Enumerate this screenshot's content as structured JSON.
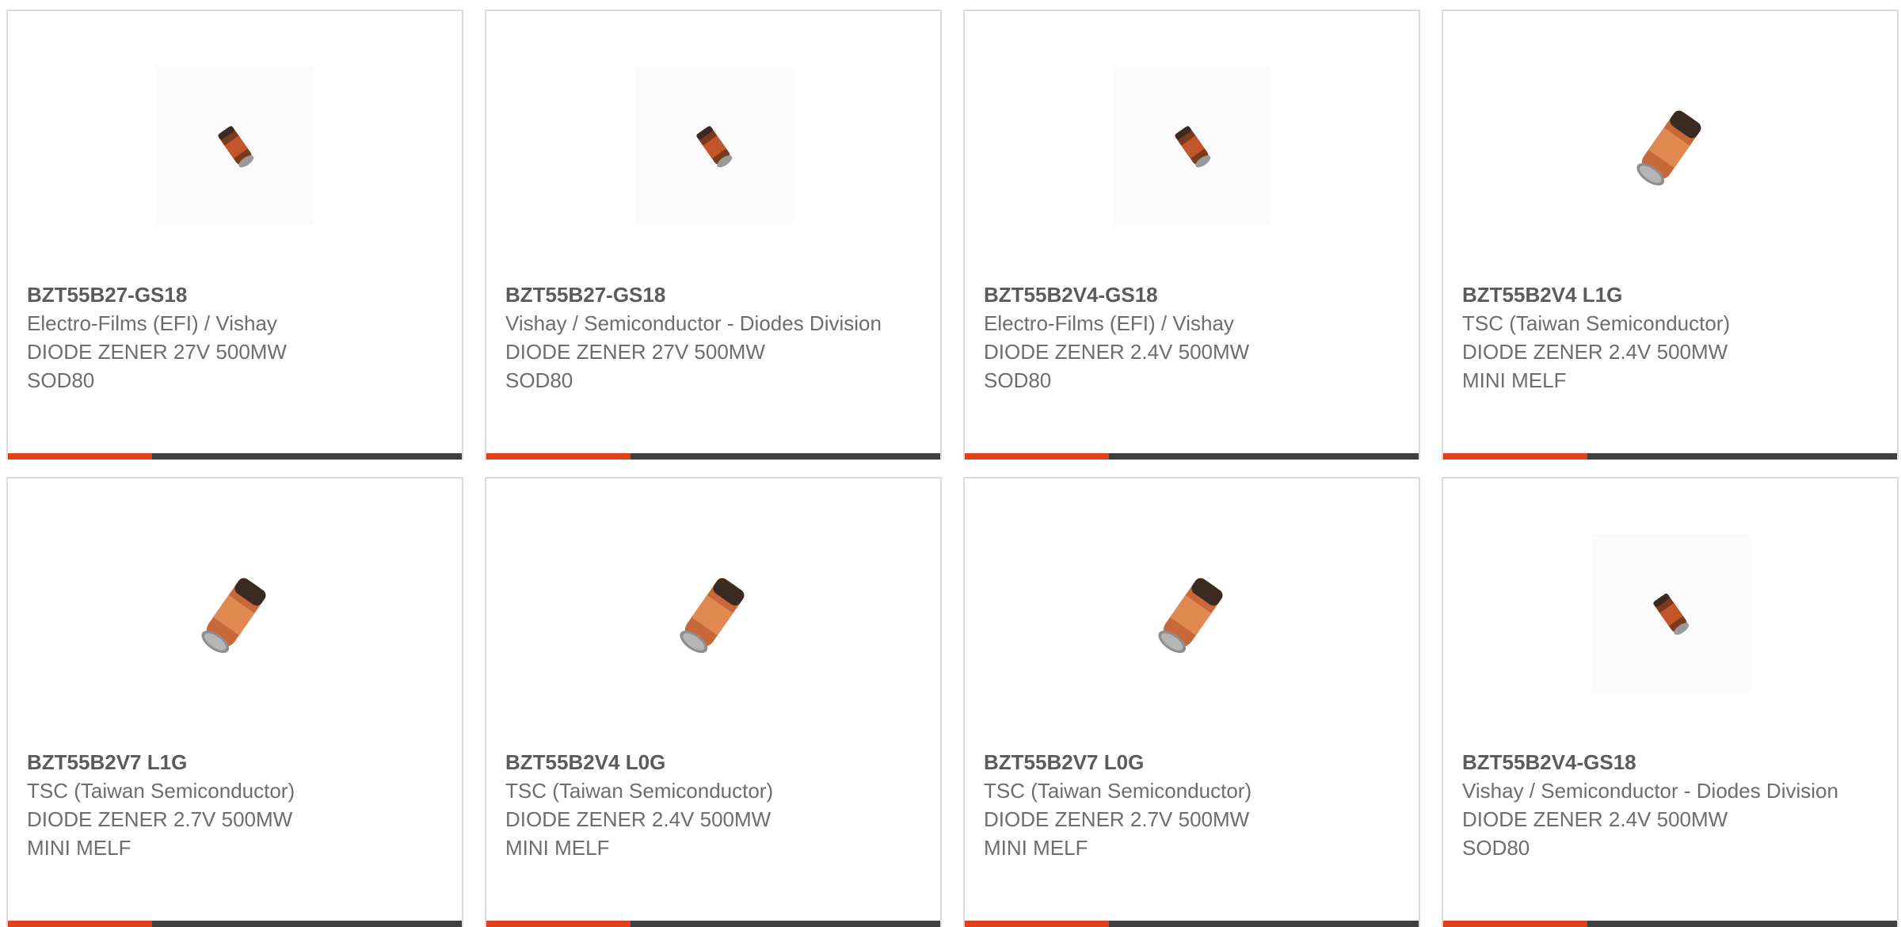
{
  "theme": {
    "accent_color": "#e0401c",
    "bar_color": "#3f3f3f"
  },
  "products": [
    {
      "part_number": "BZT55B27-GS18",
      "manufacturer": "Electro-Films (EFI) / Vishay",
      "description": "DIODE ZENER 27V 500MW",
      "package": "SOD80",
      "image_icon": "sod80-diode-icon"
    },
    {
      "part_number": "BZT55B27-GS18",
      "manufacturer": "Vishay / Semiconductor - Diodes Division",
      "description": "DIODE ZENER 27V 500MW",
      "package": "SOD80",
      "image_icon": "sod80-diode-icon"
    },
    {
      "part_number": "BZT55B2V4-GS18",
      "manufacturer": "Electro-Films (EFI) / Vishay",
      "description": "DIODE ZENER 2.4V 500MW",
      "package": "SOD80",
      "image_icon": "sod80-diode-icon"
    },
    {
      "part_number": "BZT55B2V4 L1G",
      "manufacturer": "TSC (Taiwan Semiconductor)",
      "description": "DIODE ZENER 2.4V 500MW",
      "package": "MINI MELF",
      "image_icon": "mini-melf-diode-icon"
    },
    {
      "part_number": "BZT55B2V7 L1G",
      "manufacturer": "TSC (Taiwan Semiconductor)",
      "description": "DIODE ZENER 2.7V 500MW",
      "package": "MINI MELF",
      "image_icon": "mini-melf-diode-icon"
    },
    {
      "part_number": "BZT55B2V4 L0G",
      "manufacturer": "TSC (Taiwan Semiconductor)",
      "description": "DIODE ZENER 2.4V 500MW",
      "package": "MINI MELF",
      "image_icon": "mini-melf-diode-icon"
    },
    {
      "part_number": "BZT55B2V7 L0G",
      "manufacturer": "TSC (Taiwan Semiconductor)",
      "description": "DIODE ZENER 2.7V 500MW",
      "package": "MINI MELF",
      "image_icon": "mini-melf-diode-icon"
    },
    {
      "part_number": "BZT55B2V4-GS18",
      "manufacturer": "Vishay / Semiconductor - Diodes Division",
      "description": "DIODE ZENER 2.4V 500MW",
      "package": "SOD80",
      "image_icon": "sod80-diode-icon"
    }
  ]
}
